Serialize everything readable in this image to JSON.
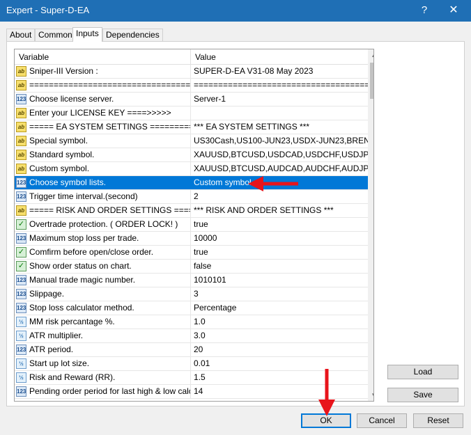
{
  "window": {
    "title": "Expert - Super-D-EA",
    "help_glyph": "?",
    "close_glyph": "✕"
  },
  "tabs": [
    {
      "label": "About",
      "active": false
    },
    {
      "label": "Common",
      "active": false
    },
    {
      "label": "Inputs",
      "active": true
    },
    {
      "label": "Dependencies",
      "active": false
    }
  ],
  "table": {
    "headers": {
      "variable": "Variable",
      "value": "Value"
    },
    "rows": [
      {
        "icon": "ab",
        "variable": "Sniper-III Version :",
        "value": "SUPER-D-EA V31-08 May 2023"
      },
      {
        "icon": "ab",
        "variable": "======================================...",
        "value": "========================================"
      },
      {
        "icon": "123",
        "variable": "Choose license server.",
        "value": "Server-1"
      },
      {
        "icon": "ab",
        "variable": "Enter your LICENSE KEY ====>>>>>",
        "value": ""
      },
      {
        "icon": "ab",
        "variable": "===== EA SYSTEM SETTINGS ============",
        "value": "*** EA SYSTEM SETTINGS ***"
      },
      {
        "icon": "ab",
        "variable": "Special symbol.",
        "value": "US30Cash,US100-JUN23,USDX-JUN23,BRENT-..."
      },
      {
        "icon": "ab",
        "variable": "Standard symbol.",
        "value": "XAUUSD,BTCUSD,USDCAD,USDCHF,USDJPY,..."
      },
      {
        "icon": "ab",
        "variable": "Custom symbol.",
        "value": "XAUUSD,BTCUSD,AUDCAD,AUDCHF,AUDJPY,..."
      },
      {
        "icon": "123",
        "variable": "Choose symbol lists.",
        "value": "Custom symbol",
        "selected": true
      },
      {
        "icon": "123",
        "variable": "Trigger time interval.(second)",
        "value": "2"
      },
      {
        "icon": "ab",
        "variable": "===== RISK AND ORDER SETTINGS =====...",
        "value": "*** RISK AND ORDER SETTINGS ***"
      },
      {
        "icon": "chk",
        "variable": "Overtrade protection. ( ORDER LOCK! )",
        "value": "true"
      },
      {
        "icon": "123",
        "variable": "Maximum stop loss per trade.",
        "value": "10000"
      },
      {
        "icon": "chk",
        "variable": "Comfirm before open/close order.",
        "value": "true"
      },
      {
        "icon": "chk",
        "variable": "Show order status on chart.",
        "value": "false"
      },
      {
        "icon": "123",
        "variable": "Manual trade magic number.",
        "value": "1010101"
      },
      {
        "icon": "123",
        "variable": "Slippage.",
        "value": "3"
      },
      {
        "icon": "123",
        "variable": "Stop loss calculator method.",
        "value": "Percentage"
      },
      {
        "icon": "half",
        "variable": "MM risk percantage %.",
        "value": "1.0"
      },
      {
        "icon": "half",
        "variable": "ATR multiplier.",
        "value": "3.0"
      },
      {
        "icon": "123",
        "variable": "ATR period.",
        "value": "20"
      },
      {
        "icon": "half",
        "variable": "Start up lot size.",
        "value": "0.01"
      },
      {
        "icon": "half",
        "variable": "Risk and Reward (RR).",
        "value": "1.5"
      },
      {
        "icon": "123",
        "variable": "Pending order period for last high & low calcul...",
        "value": "14"
      }
    ]
  },
  "icon_glyphs": {
    "ab": "ab",
    "123": "123",
    "half": "½",
    "chk": "✓"
  },
  "side_buttons": {
    "load": "Load",
    "save": "Save"
  },
  "footer_buttons": {
    "ok": "OK",
    "cancel": "Cancel",
    "reset": "Reset"
  },
  "colors": {
    "titlebar": "#1f6fb5",
    "selection": "#0078d7",
    "annotation_arrow": "#e8141b"
  }
}
